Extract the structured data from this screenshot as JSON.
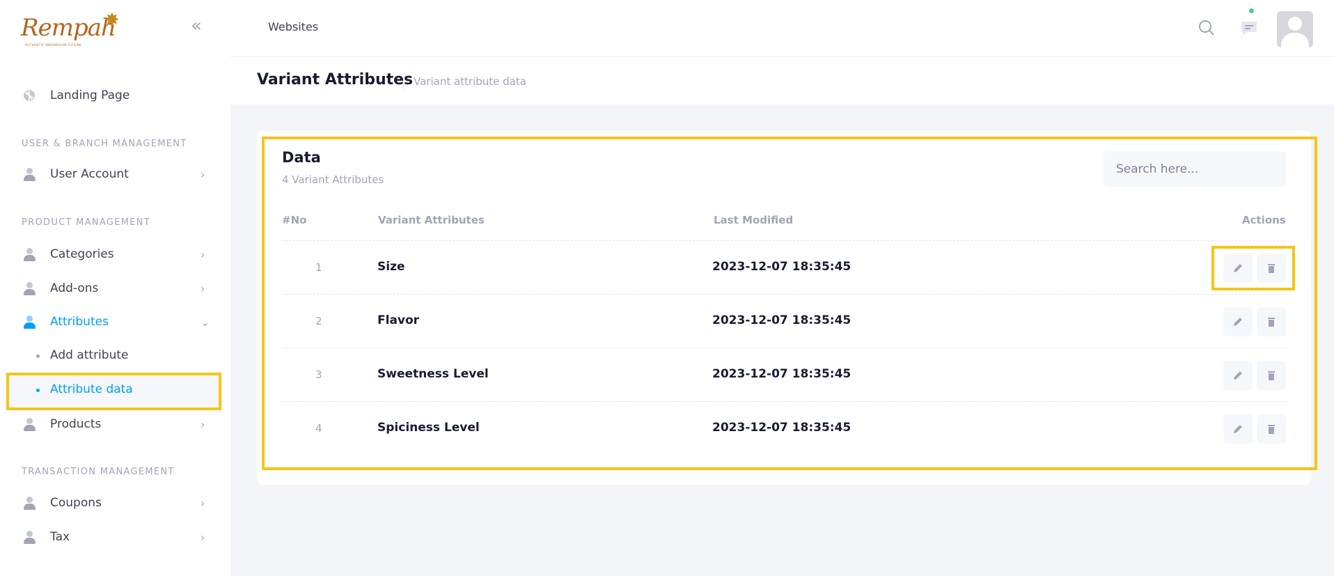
{
  "brand": {
    "logo_text": "Rempah",
    "logo_tagline": "AUTHENTIC INDONESIAN CUISINE"
  },
  "sidebar": {
    "landing": "Landing Page",
    "sections": [
      "User & Branch Management",
      "Product Management",
      "Transaction Management"
    ],
    "items": {
      "user_account": "User Account",
      "categories": "Categories",
      "addons": "Add-ons",
      "attributes": "Attributes",
      "add_attribute": "Add attribute",
      "attribute_data": "Attribute data",
      "products": "Products",
      "coupons": "Coupons",
      "tax": "Tax"
    },
    "active": "Attribute data"
  },
  "topbar": {
    "title": "Websites"
  },
  "page": {
    "title": "Variant Attributes",
    "description": "Variant attribute data"
  },
  "card": {
    "title": "Data",
    "subtitle": "4 Variant Attributes",
    "search_placeholder": "Search here...",
    "columns": [
      "#No",
      "Variant Attributes",
      "Last Modified",
      "Actions"
    ],
    "rows": [
      {
        "no": "1",
        "name": "Size",
        "modified": "2023-12-07 18:35:45"
      },
      {
        "no": "2",
        "name": "Flavor",
        "modified": "2023-12-07 18:35:45"
      },
      {
        "no": "3",
        "name": "Sweetness Level",
        "modified": "2023-12-07 18:35:45"
      },
      {
        "no": "4",
        "name": "Spiciness Level",
        "modified": "2023-12-07 18:35:45"
      }
    ]
  },
  "colors": {
    "primary": "#009ef7",
    "highlight": "#f5c518",
    "muted": "#a1a5b7",
    "status_online": "#50cd89"
  },
  "icons": [
    "double-chevron-left-icon",
    "search-icon",
    "chat-icon",
    "user-icon",
    "edit-icon",
    "trash-icon",
    "chevron-right-icon",
    "chevron-down-icon"
  ]
}
